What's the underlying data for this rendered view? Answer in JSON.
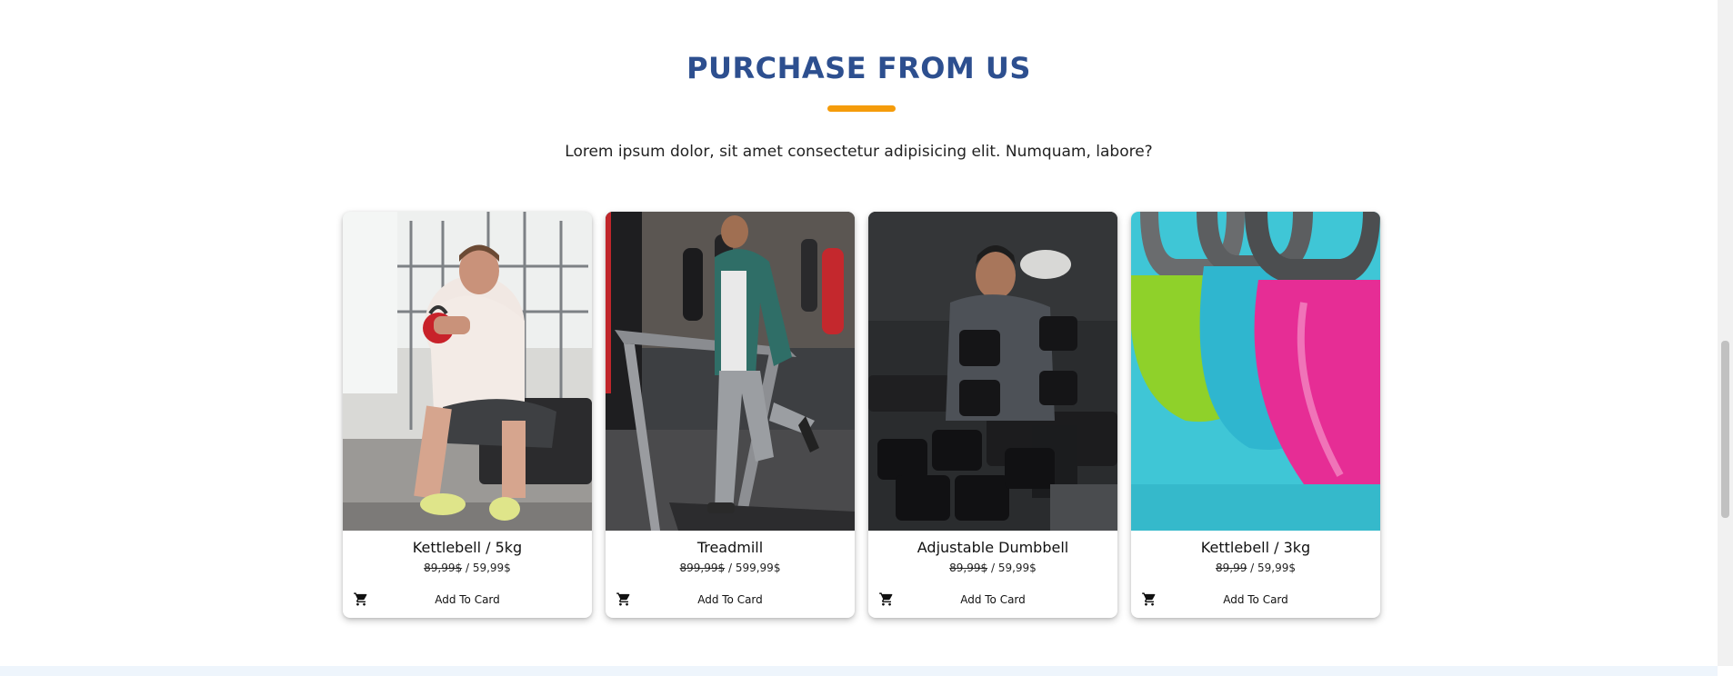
{
  "section": {
    "title": "PURCHASE FROM US",
    "subtitle": "Lorem ipsum dolor, sit amet consectetur adipisicing elit. Numquam, labore?",
    "accent_color": "#f59c0b",
    "title_color": "#2d4f8f"
  },
  "products": [
    {
      "name": "Kettlebell / 5kg",
      "old_price": "89,99$",
      "separator": " / ",
      "new_price": "59,99$",
      "button": "Add To Card",
      "icon": "cart-icon",
      "image": "man-with-kettlebell-photo"
    },
    {
      "name": "Treadmill",
      "old_price": "899,99$",
      "separator": " / ",
      "new_price": "599,99$",
      "button": "Add To Card",
      "icon": "cart-icon",
      "image": "man-on-treadmill-photo"
    },
    {
      "name": "Adjustable Dumbbell",
      "old_price": "89,99$",
      "separator": " / ",
      "new_price": "59,99$",
      "button": "Add To Card",
      "icon": "cart-icon",
      "image": "man-with-dumbbells-photo"
    },
    {
      "name": "Kettlebell / 3kg",
      "old_price": "89,99",
      "separator": " / ",
      "new_price": "59,99$",
      "button": "Add To Card",
      "icon": "cart-icon",
      "image": "colorful-kettlebells-photo"
    }
  ]
}
